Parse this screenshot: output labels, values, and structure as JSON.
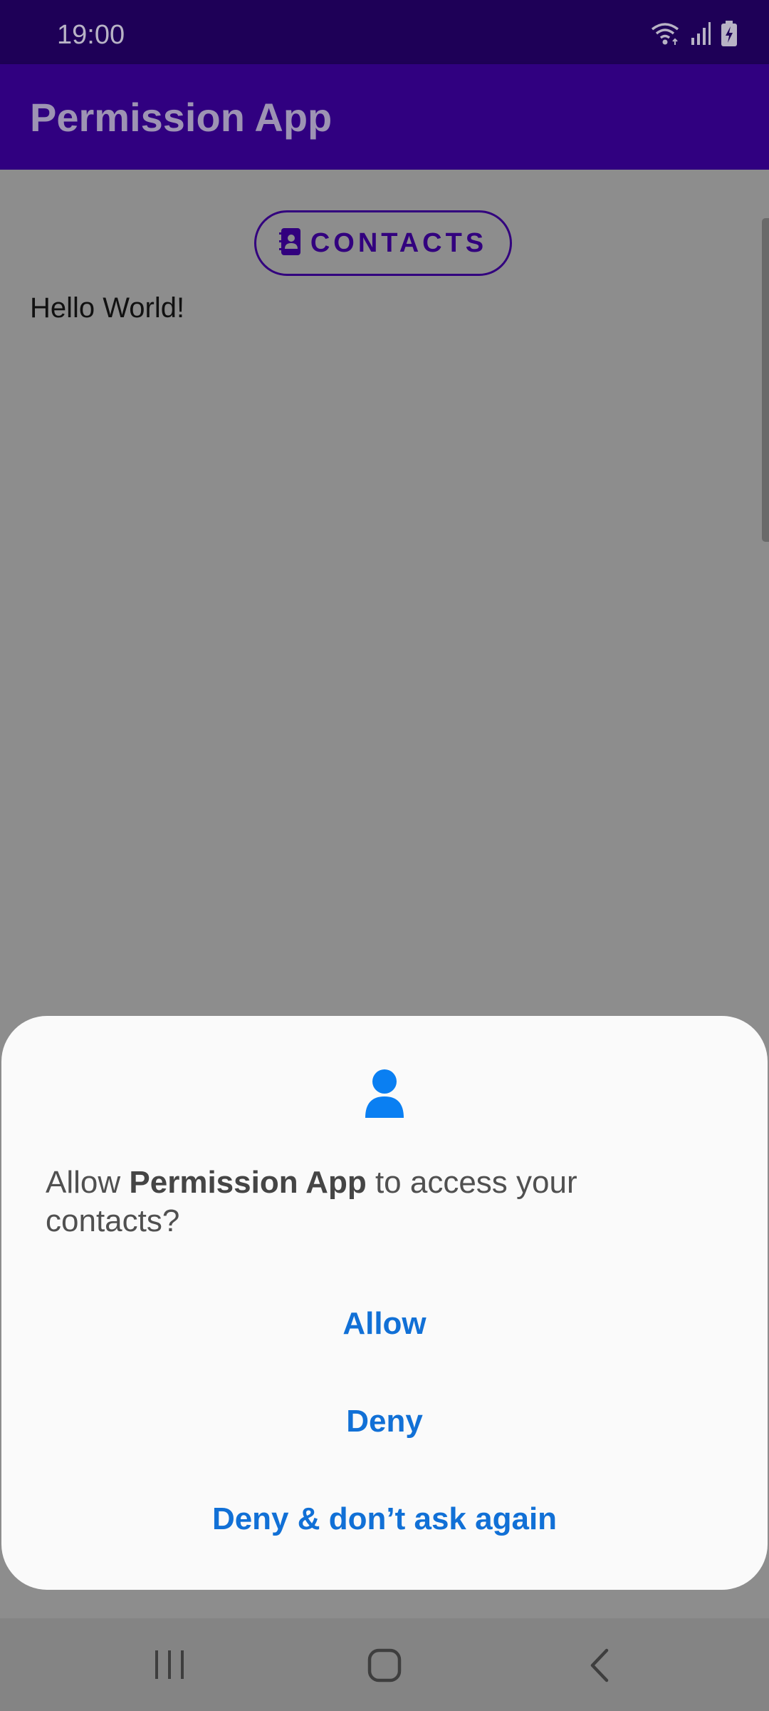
{
  "status_bar": {
    "time": "19:00",
    "icons": [
      "wifi-icon",
      "signal-icon",
      "battery-charging-icon"
    ]
  },
  "app_bar": {
    "title": "Permission App"
  },
  "main": {
    "contacts_button_label": "CONTACTS",
    "contacts_button_icon": "contacts-book-icon",
    "hello_text": "Hello World!"
  },
  "dialog": {
    "icon": "person-icon",
    "message_prefix": "Allow ",
    "app_name": "Permission App",
    "message_suffix": " to access your contacts?",
    "allow_label": "Allow",
    "deny_label": "Deny",
    "deny_dont_ask_label": "Deny & don’t ask again"
  },
  "nav_bar": {
    "icons": [
      "recents-icon",
      "home-icon",
      "back-icon"
    ]
  },
  "colors": {
    "status_bar": "#1e0057",
    "app_bar": "#300080",
    "accent": "#32007e",
    "dialog_button": "#1170d6",
    "scrim_background": "#8d8d8d"
  }
}
